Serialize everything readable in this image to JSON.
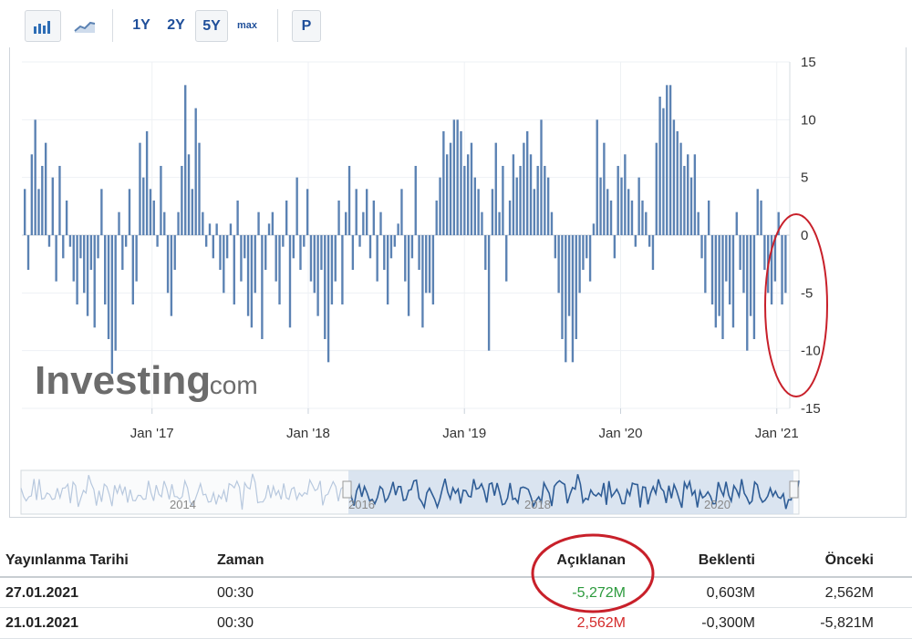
{
  "toolbar": {
    "bar_chart_icon": "bar-chart-icon",
    "line_chart_icon": "line-chart-icon",
    "ranges": [
      "1Y",
      "2Y",
      "5Y",
      "max"
    ],
    "selected_range": "5Y",
    "p_label": "P"
  },
  "watermark": {
    "brand": "Investing",
    "suffix": ".com"
  },
  "navigator": {
    "labels": [
      "2014",
      "2016",
      "2018",
      "2020"
    ]
  },
  "chart_data": {
    "type": "bar",
    "x_range": [
      "2016-03",
      "2021-02"
    ],
    "x_tick_labels": [
      "Jan '17",
      "Jan '18",
      "Jan '19",
      "Jan '20",
      "Jan '21"
    ],
    "y_tick_labels": [
      "15",
      "10",
      "5",
      "0",
      "-5",
      "-10",
      "-15"
    ],
    "ylim": [
      -15,
      15
    ],
    "grid": true,
    "bar_color": "#5b82b3",
    "values": [
      4,
      -3,
      7,
      10,
      4,
      6,
      8,
      -1,
      5,
      -4,
      6,
      -2,
      3,
      -1,
      -4,
      -6,
      -2,
      -5,
      -7,
      -3,
      -8,
      -2,
      4,
      -6,
      -9,
      -12,
      -10,
      2,
      -3,
      -1,
      4,
      -6,
      -4,
      8,
      5,
      9,
      4,
      3,
      -1,
      6,
      2,
      -5,
      -7,
      -3,
      2,
      6,
      13,
      7,
      4,
      11,
      8,
      2,
      -1,
      1,
      -2,
      1,
      -3,
      -5,
      -2,
      1,
      -6,
      3,
      -4,
      -2,
      -7,
      -8,
      -5,
      2,
      -9,
      -3,
      1,
      2,
      -4,
      -6,
      -1,
      3,
      -8,
      -2,
      5,
      -3,
      -1,
      4,
      -4,
      -5,
      -7,
      -3,
      -9,
      -11,
      -6,
      -4,
      3,
      -6,
      2,
      6,
      -3,
      4,
      -1,
      2,
      4,
      -2,
      3,
      -4,
      2,
      -3,
      -6,
      -2,
      -1,
      1,
      4,
      -4,
      -7,
      -2,
      6,
      -3,
      -8,
      -5,
      -5,
      -6,
      3,
      5,
      9,
      7,
      8,
      10,
      10,
      9,
      6,
      7,
      8,
      5,
      4,
      2,
      -3,
      -10,
      4,
      8,
      2,
      6,
      -4,
      3,
      7,
      5,
      6,
      8,
      9,
      7,
      4,
      6,
      10,
      6,
      5,
      2,
      -2,
      -5,
      -9,
      -11,
      -7,
      -11,
      -9,
      -5,
      -3,
      -2,
      -4,
      1,
      10,
      5,
      8,
      4,
      3,
      -2,
      6,
      5,
      7,
      4,
      3,
      -1,
      5,
      3,
      2,
      -1,
      -3,
      8,
      12,
      11,
      13,
      13,
      10,
      9,
      8,
      6,
      7,
      5,
      7,
      2,
      -2,
      -5,
      3,
      -6,
      -8,
      -7,
      -9,
      -4,
      -6,
      -8,
      2,
      -3,
      -5,
      -10,
      -7,
      -9,
      4,
      3,
      -3,
      -5,
      -6,
      -4,
      2,
      -6,
      -5
    ]
  },
  "table": {
    "headers": {
      "date": "Yayınlanma Tarihi",
      "time": "Zaman",
      "actual": "Açıklanan",
      "forecast": "Beklenti",
      "previous": "Önceki"
    },
    "rows": [
      {
        "date": "27.01.2021",
        "time": "00:30",
        "actual": "-5,272M",
        "actual_color": "#2c9a3d",
        "forecast": "0,603M",
        "previous": "2,562M"
      },
      {
        "date": "21.01.2021",
        "time": "00:30",
        "actual": "2,562M",
        "actual_color": "#d42a2a",
        "forecast": "-0,300M",
        "previous": "-5,821M"
      }
    ]
  },
  "annotation_color": "#c8202a"
}
